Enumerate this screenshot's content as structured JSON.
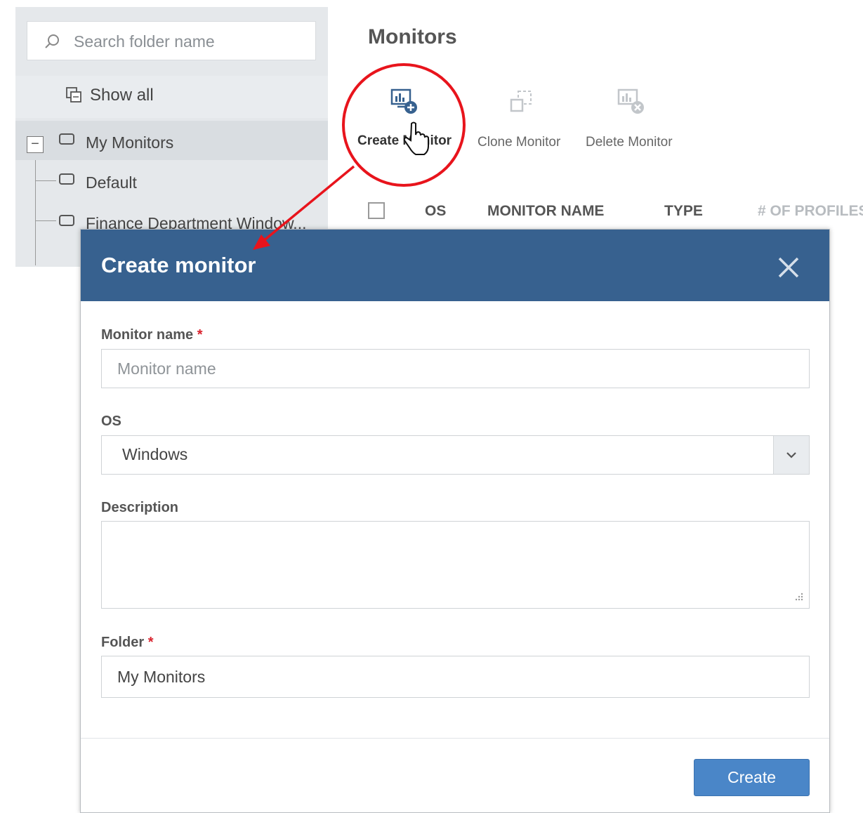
{
  "sidebar": {
    "search_placeholder": "Search folder name",
    "show_all": "Show all",
    "tree": {
      "root": "My Monitors",
      "children": [
        "Default",
        "Finance Department Window..."
      ]
    }
  },
  "main": {
    "title": "Monitors",
    "toolbar": {
      "create": "Create Monitor",
      "clone": "Clone Monitor",
      "delete": "Delete Monitor"
    },
    "table_headers": [
      "OS",
      "MONITOR NAME",
      "TYPE",
      "# OF PROFILES"
    ]
  },
  "dialog": {
    "title": "Create monitor",
    "fields": {
      "monitor_name": {
        "label": "Monitor name",
        "required_mark": "*",
        "placeholder": "Monitor name",
        "value": ""
      },
      "os": {
        "label": "OS",
        "value": "Windows"
      },
      "description": {
        "label": "Description",
        "value": ""
      },
      "folder": {
        "label": "Folder",
        "required_mark": "*",
        "value": "My Monitors"
      }
    },
    "create_button": "Create"
  },
  "colors": {
    "dialog_header": "#37618f",
    "primary_button": "#4a86c8",
    "highlight_annotation": "#e8141c",
    "required_asterisk": "#d9232e"
  },
  "icons": [
    "search-icon",
    "show-all-icon",
    "folder-icon",
    "create-monitor-icon",
    "clone-monitor-icon",
    "delete-monitor-icon",
    "close-icon",
    "chevron-down-icon",
    "hand-cursor-icon"
  ]
}
